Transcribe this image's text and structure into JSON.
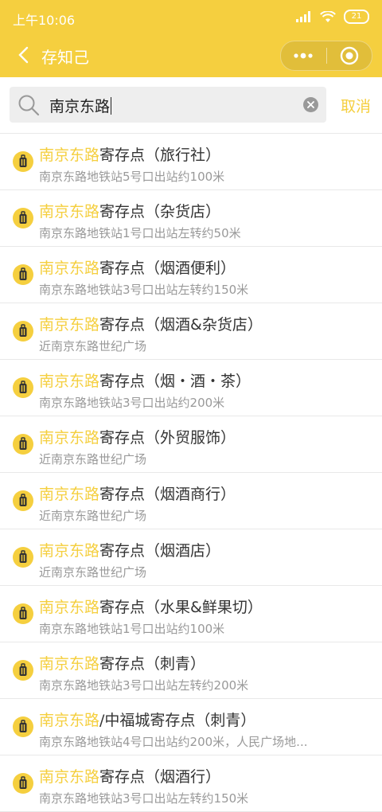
{
  "status": {
    "time": "上午10:06",
    "battery": "21"
  },
  "nav": {
    "title": "存知己"
  },
  "search": {
    "value": "南京东路",
    "cancel_label": "取消"
  },
  "colors": {
    "accent": "#f5cf3f",
    "highlight": "#f5cf3f",
    "subtext": "#999999"
  },
  "results": [
    {
      "hl": "南京东路",
      "rest": "寄存点（旅行社）",
      "sub": "南京东路地铁站5号口出站约100米"
    },
    {
      "hl": "南京东路",
      "rest": "寄存点（杂货店）",
      "sub": "南京东路地铁站1号口出站左转约50米"
    },
    {
      "hl": "南京东路",
      "rest": "寄存点（烟酒便利）",
      "sub": "南京东路地铁站3号口出站左转约150米"
    },
    {
      "hl": "南京东路",
      "rest": "寄存点（烟酒&杂货店）",
      "sub": "近南京东路世纪广场"
    },
    {
      "hl": "南京东路",
      "rest": "寄存点（烟・酒・茶）",
      "sub": "南京东路地铁站3号口出站约200米"
    },
    {
      "hl": "南京东路",
      "rest": "寄存点（外贸服饰）",
      "sub": "近南京东路世纪广场"
    },
    {
      "hl": "南京东路",
      "rest": "寄存点（烟酒商行）",
      "sub": "近南京东路世纪广场"
    },
    {
      "hl": "南京东路",
      "rest": "寄存点（烟酒店）",
      "sub": "近南京东路世纪广场"
    },
    {
      "hl": "南京东路",
      "rest": "寄存点（水果&鲜果切）",
      "sub": "南京东路地铁站1号口出站约100米"
    },
    {
      "hl": "南京东路",
      "rest": "寄存点（刺青）",
      "sub": "南京东路地铁站3号口出站左转约200米"
    },
    {
      "hl": "南京东路",
      "rest": "/中福城寄存点（刺青）",
      "sub": "南京东路地铁站4号口出站约200米，人民广场地..."
    },
    {
      "hl": "南京东路",
      "rest": "寄存点（烟酒行）",
      "sub": "南京东路地铁站3号口出站左转约150米"
    }
  ]
}
